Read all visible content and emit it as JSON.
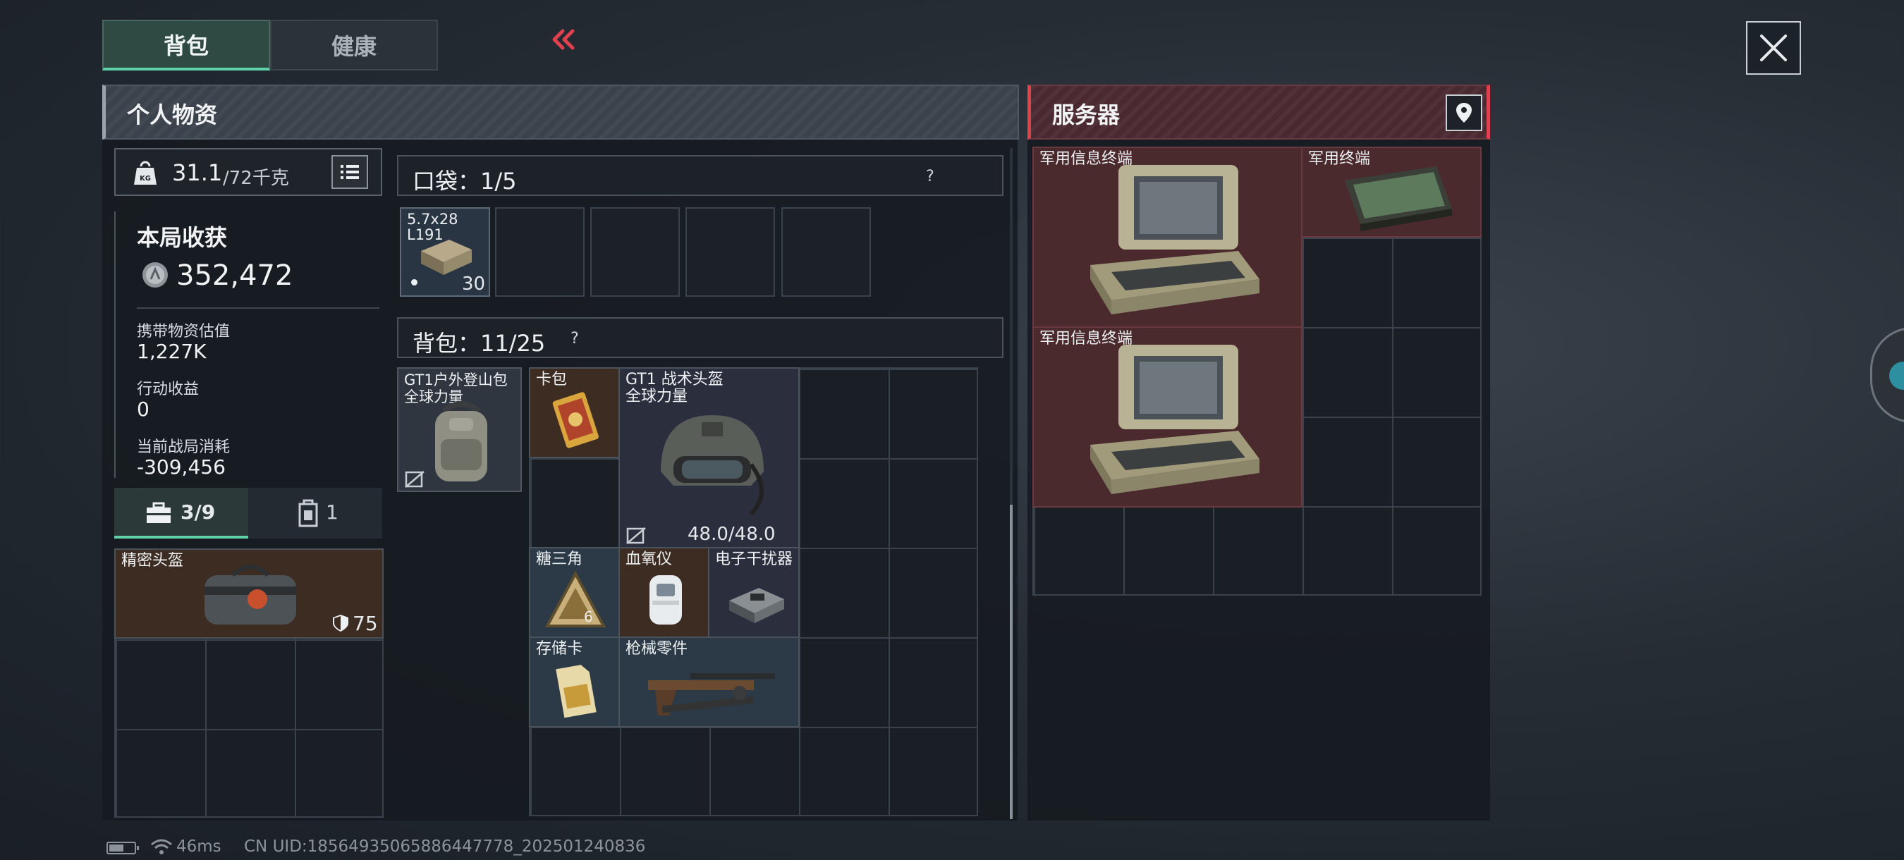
{
  "tabs": {
    "backpack": "背包",
    "health": "健康"
  },
  "personal": {
    "title": "个人物资"
  },
  "server": {
    "title": "服务器"
  },
  "weight": {
    "current": "31.1",
    "max": "/72千克"
  },
  "session": {
    "title": "本局收获",
    "coins": "352,472",
    "carried_label": "携带物资估值",
    "carried_value": "1,227K",
    "action_label": "行动收益",
    "action_value": "0",
    "consume_label": "当前战局消耗",
    "consume_value": "-309,456"
  },
  "subtabs": {
    "kit": "3/9",
    "case": "1"
  },
  "helmet_case": {
    "label": "精密头盔",
    "armor": "75"
  },
  "pocket": {
    "title": "口袋：1/5",
    "q": "?",
    "ammo_label": "5.7x28\nL191",
    "ammo_count": "30"
  },
  "backpack": {
    "title": "背包：11/25",
    "q": "?"
  },
  "items": {
    "bag": "GT1户外登山包\n全球力量",
    "cardpack": "卡包",
    "helmet": "GT1 战术头盔\n全球力量",
    "helmet_dur": "48.0/48.0",
    "triangle": "糖三角",
    "oximeter": "血氧仪",
    "jammer": "电子干扰器",
    "sdcard": "存储卡",
    "gunparts": "枪械零件"
  },
  "server_items": {
    "terminal1": "军用信息终端",
    "terminal2": "军用终端",
    "terminal3": "军用信息终端"
  },
  "status": {
    "ping": "46ms",
    "uid": "CN UID:18564935065886447778_202501240836"
  },
  "colors": {
    "accent": "#5fd2a9",
    "server_header": "#4a2a30",
    "server_item": "#4b2a2e",
    "gold_item": "#3d2c22"
  }
}
